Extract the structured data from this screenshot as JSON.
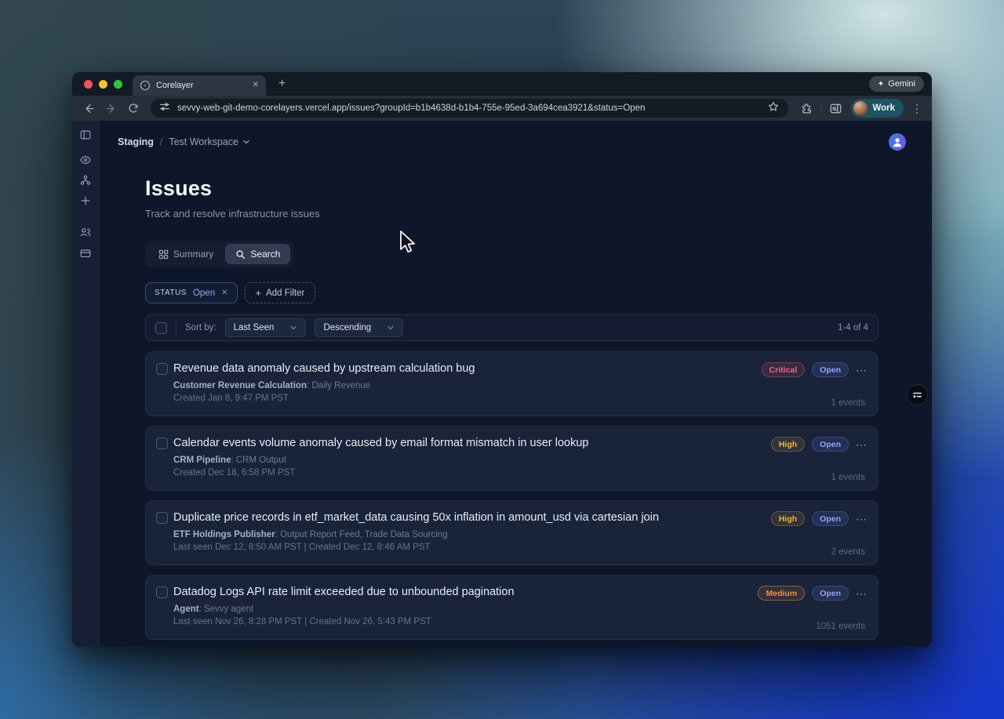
{
  "browser": {
    "tab_title": "Corelayer",
    "gemini_label": "Gemini",
    "url": "sevvy-web-git-demo-corelayers.vercel.app/issues?groupId=b1b4638d-b1b4-755e-95ed-3a694cea3921&status=Open",
    "profile_label": "Work"
  },
  "icons": {
    "gemini_sparkle": "✦",
    "new_tab": "+",
    "tab_close": "✕",
    "menu_kebab": "⋮",
    "card_menu": "⋯",
    "chip_close": "✕",
    "add_filter_plus": "+"
  },
  "app": {
    "breadcrumb": {
      "environment": "Staging",
      "separator": "/",
      "workspace": "Test Workspace"
    },
    "page_title": "Issues",
    "page_subtitle": "Track and resolve infrastructure issues",
    "view_tabs": [
      {
        "label": "Summary"
      },
      {
        "label": "Search"
      }
    ],
    "filter": {
      "key": "STATUS",
      "value": "Open"
    },
    "add_filter_label": "Add Filter",
    "sort": {
      "label": "Sort by:",
      "field": "Last Seen",
      "direction": "Descending",
      "result_count": "1-4 of 4"
    },
    "meta_separator": ": ",
    "issues": [
      {
        "title": "Revenue data anomaly caused by upstream calculation bug",
        "source": "Customer Revenue Calculation",
        "source_detail": "Daily Revenue",
        "timestamps": "Created Jan 8, 9:47 PM PST",
        "severity": "Critical",
        "status": "Open",
        "events": "1 events"
      },
      {
        "title": "Calendar events volume anomaly caused by email format mismatch in user lookup",
        "source": "CRM Pipeline",
        "source_detail": "CRM Output",
        "timestamps": "Created Dec 18, 6:58 PM PST",
        "severity": "High",
        "status": "Open",
        "events": "1 events"
      },
      {
        "title": "Duplicate price records in etf_market_data causing 50x inflation in amount_usd via cartesian join",
        "source": "ETF Holdings Publisher",
        "source_detail": "Output Report Feed, Trade Data Sourcing",
        "timestamps": "Last seen Dec 12, 8:50 AM PST | Created Dec 12, 8:46 AM PST",
        "severity": "High",
        "status": "Open",
        "events": "2 events"
      },
      {
        "title": "Datadog Logs API rate limit exceeded due to unbounded pagination",
        "source": "Agent",
        "source_detail": "Sevvy agent",
        "timestamps": "Last seen Nov 26, 8:28 PM PST | Created Nov 26, 5:43 PM PST",
        "severity": "Medium",
        "status": "Open",
        "events": "1051 events"
      }
    ]
  },
  "colors": {
    "severity_critical": "#f06a86",
    "severity_high": "#f2b43c",
    "severity_medium": "#f0913f",
    "status_open": "#93a5f2",
    "profile_pill": "#1d5362",
    "page_bg": "#0e1729",
    "card_bg": "#192339"
  }
}
